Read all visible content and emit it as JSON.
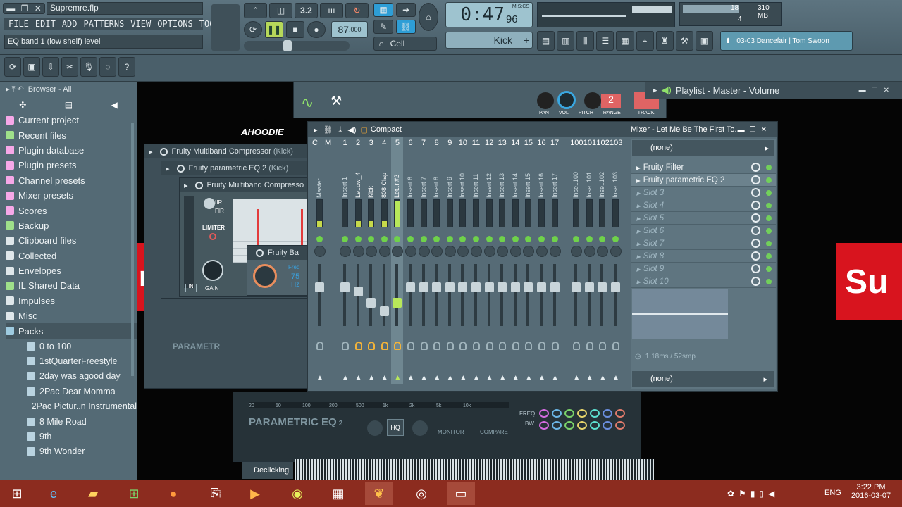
{
  "app": {
    "file": "Supremre.flp",
    "hint": "EQ band 1 (low shelf) level",
    "menu": [
      "FILE",
      "EDIT",
      "ADD",
      "PATTERNS",
      "VIEW",
      "OPTIONS",
      "TOOLS",
      "?"
    ]
  },
  "transport": {
    "tempo": "87",
    "tempo_dec": ".000",
    "time": "0:47",
    "time_sub": "96",
    "time_unit": "M:S:CS",
    "pattern": "Kick",
    "snap": "Cell",
    "cpu_val": "18",
    "mem": "310 MB",
    "poly": "4",
    "news": "03-03  Dancefair | Tom Swoon"
  },
  "browser": {
    "title": "Browser - All",
    "items": [
      "Current project",
      "Recent files",
      "Plugin database",
      "Plugin presets",
      "Channel presets",
      "Mixer presets",
      "Scores",
      "Backup",
      "Clipboard files",
      "Collected",
      "Envelopes",
      "IL Shared Data",
      "Impulses",
      "Misc",
      "Packs"
    ],
    "packs": [
      "0 to 100",
      "1stQuarterFreestyle",
      "2day was agood day",
      "2Pac Dear Momma",
      "2Pac Pictur..n Instrumental",
      "8 Mile Road",
      "9th",
      "9th Wonder"
    ],
    "icon_colors": [
      "#f7a8e8",
      "#9fe08a",
      "#f7a8e8",
      "#f7a8e8",
      "#f7a8e8",
      "#f7a8e8",
      "#f7a8e8",
      "#9fe08a",
      "#dfe7ea",
      "#dfe7ea",
      "#dfe7ea",
      "#9fe08a",
      "#dfe7ea",
      "#dfe7ea",
      "#9ecbe0"
    ]
  },
  "channel": {
    "labels": [
      "PAN",
      "VOL",
      "PITCH",
      "RANGE",
      "TRACK"
    ],
    "range": "2"
  },
  "playlist": {
    "title": "Playlist - Master - Volume"
  },
  "plugins": {
    "w1": "Fruity Multiband Compressor",
    "w1k": "(Kick)",
    "w2": "Fruity parametric EQ 2",
    "w2k": "(Kick)",
    "w3": "Fruity Multiband Compresso",
    "w4": "Fruity Ba",
    "iir": "IIR",
    "fir": "FIR",
    "limiter": "LIMITER",
    "gain": "GAIN",
    "in": "IN",
    "freq": "Freq",
    "freq_val": "75",
    "hz": "Hz",
    "peq": "PARAMETRIC EQ",
    "peq2": "2",
    "freq_lbl": "FREQ",
    "bw": "BW",
    "monitor": "MONITOR",
    "compare": "COMPARE",
    "hq": "HQ",
    "parametric_back": "PARAMETR",
    "ticks": [
      "20",
      "50",
      "100",
      "200",
      "500",
      "1k",
      "2k",
      "5k",
      "10k"
    ],
    "declicking": "Declicking",
    "ahoodie": "AHOODIE"
  },
  "mixer": {
    "title": "Mixer - Let Me Be The First To..",
    "view": "Compact",
    "top_cm": [
      "C",
      "M"
    ],
    "numbers": [
      "1",
      "2",
      "3",
      "4",
      "5",
      "6",
      "7",
      "8",
      "9",
      "10",
      "11",
      "12",
      "13",
      "14",
      "15",
      "16",
      "17",
      "100",
      "101",
      "102",
      "103"
    ],
    "names": [
      "Master",
      "Insert 1",
      "Le..ow_4",
      "Kick",
      "808 Clap",
      "Let..r #2",
      "Insert 6",
      "Insert 7",
      "Insert 8",
      "Insert 9",
      "Insert 10",
      "Insert 11",
      "Insert 12",
      "Insert 13",
      "Insert 14",
      "Insert 15",
      "Insert 16",
      "Insert 17",
      "Inse..100",
      "Inse..101",
      "Inse..102",
      "Inse..103"
    ],
    "fx_in": "(none)",
    "fx_out": "(none)",
    "slots": [
      "Fruity Filter",
      "Fruity parametric EQ 2",
      "Slot 3",
      "Slot 4",
      "Slot 5",
      "Slot 6",
      "Slot 7",
      "Slot 8",
      "Slot 9",
      "Slot 10"
    ],
    "latency": "1.18ms / 52smp"
  },
  "supreme": {
    "left": "m",
    "right": "Su"
  },
  "clock": {
    "time": "3:22 PM",
    "date": "2016-03-07",
    "lang": "ENG"
  }
}
